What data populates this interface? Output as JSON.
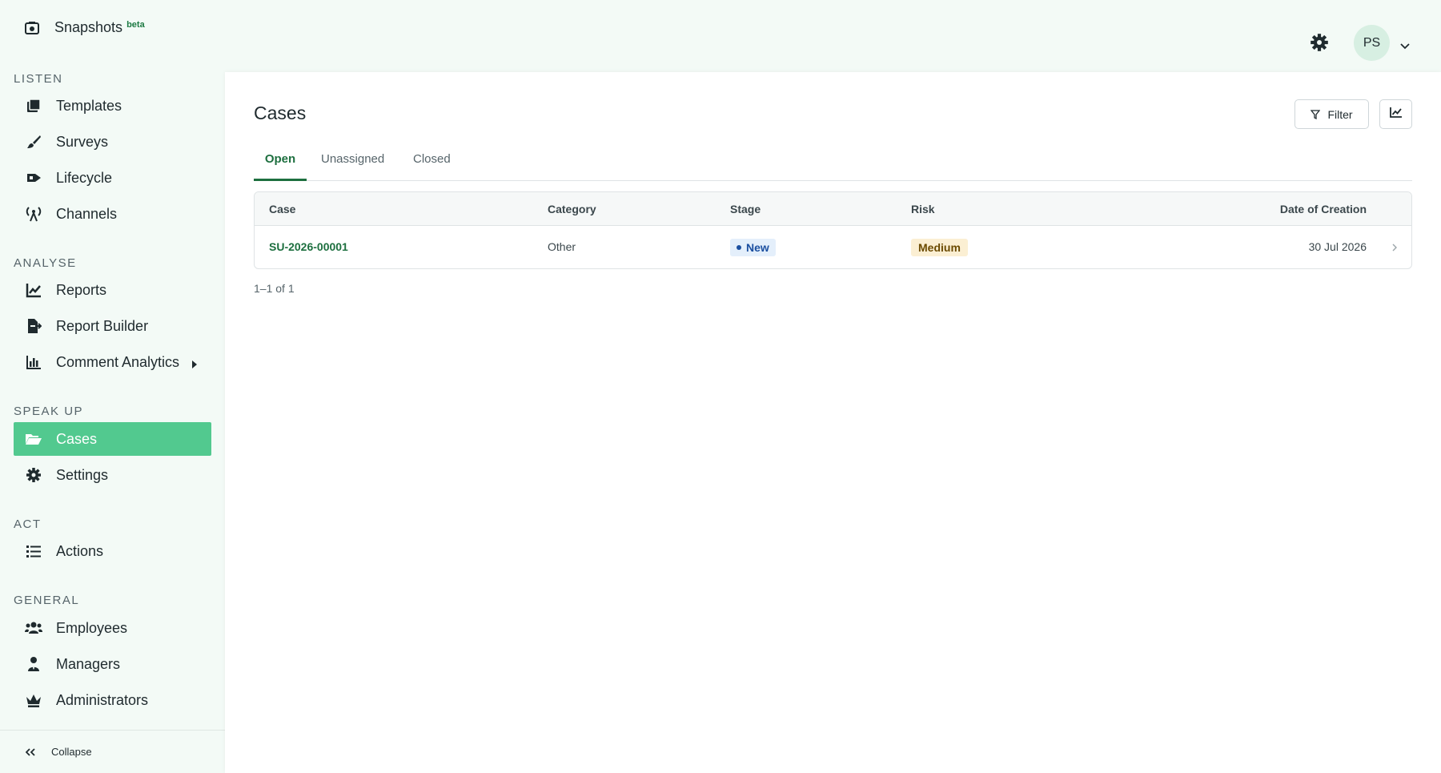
{
  "brand": {
    "name": "Snapshots",
    "badge": "beta"
  },
  "sidebar": {
    "sections": [
      {
        "title": "LISTEN",
        "items": [
          {
            "label": "Templates",
            "icon": "templates-icon"
          },
          {
            "label": "Surveys",
            "icon": "brush-icon"
          },
          {
            "label": "Lifecycle",
            "icon": "lifecycle-icon"
          },
          {
            "label": "Channels",
            "icon": "broadcast-icon"
          }
        ]
      },
      {
        "title": "ANALYSE",
        "items": [
          {
            "label": "Reports",
            "icon": "line-chart-icon"
          },
          {
            "label": "Report Builder",
            "icon": "file-export-icon"
          },
          {
            "label": "Comment Analytics",
            "icon": "bar-chart-icon",
            "has_submenu": true
          }
        ]
      },
      {
        "title": "SPEAK UP",
        "items": [
          {
            "label": "Cases",
            "icon": "folder-open-icon",
            "active": true
          },
          {
            "label": "Settings",
            "icon": "gear-icon"
          }
        ]
      },
      {
        "title": "ACT",
        "items": [
          {
            "label": "Actions",
            "icon": "list-icon"
          }
        ]
      },
      {
        "title": "GENERAL",
        "items": [
          {
            "label": "Employees",
            "icon": "users-icon"
          },
          {
            "label": "Managers",
            "icon": "user-tie-icon"
          },
          {
            "label": "Administrators",
            "icon": "crown-icon"
          }
        ]
      }
    ],
    "collapse_label": "Collapse"
  },
  "topbar": {
    "avatar_initials": "PS"
  },
  "main": {
    "title": "Cases",
    "filter_label": "Filter",
    "tabs": [
      {
        "label": "Open",
        "active": true
      },
      {
        "label": "Unassigned"
      },
      {
        "label": "Closed"
      }
    ],
    "table": {
      "columns": [
        "Case",
        "Category",
        "Stage",
        "Risk",
        "Date of Creation"
      ],
      "rows": [
        {
          "case": "SU-2026-00001",
          "category": "Other",
          "stage": "New",
          "risk": "Medium",
          "date": "30 Jul 2026"
        }
      ]
    },
    "pagination": "1–1 of 1"
  },
  "colors": {
    "accent": "#52c98f",
    "link": "#1d6f3f",
    "sidebar_bg": "#f3faf6",
    "stage_new_bg": "#e4effb",
    "risk_medium_bg": "#fbefd3"
  }
}
